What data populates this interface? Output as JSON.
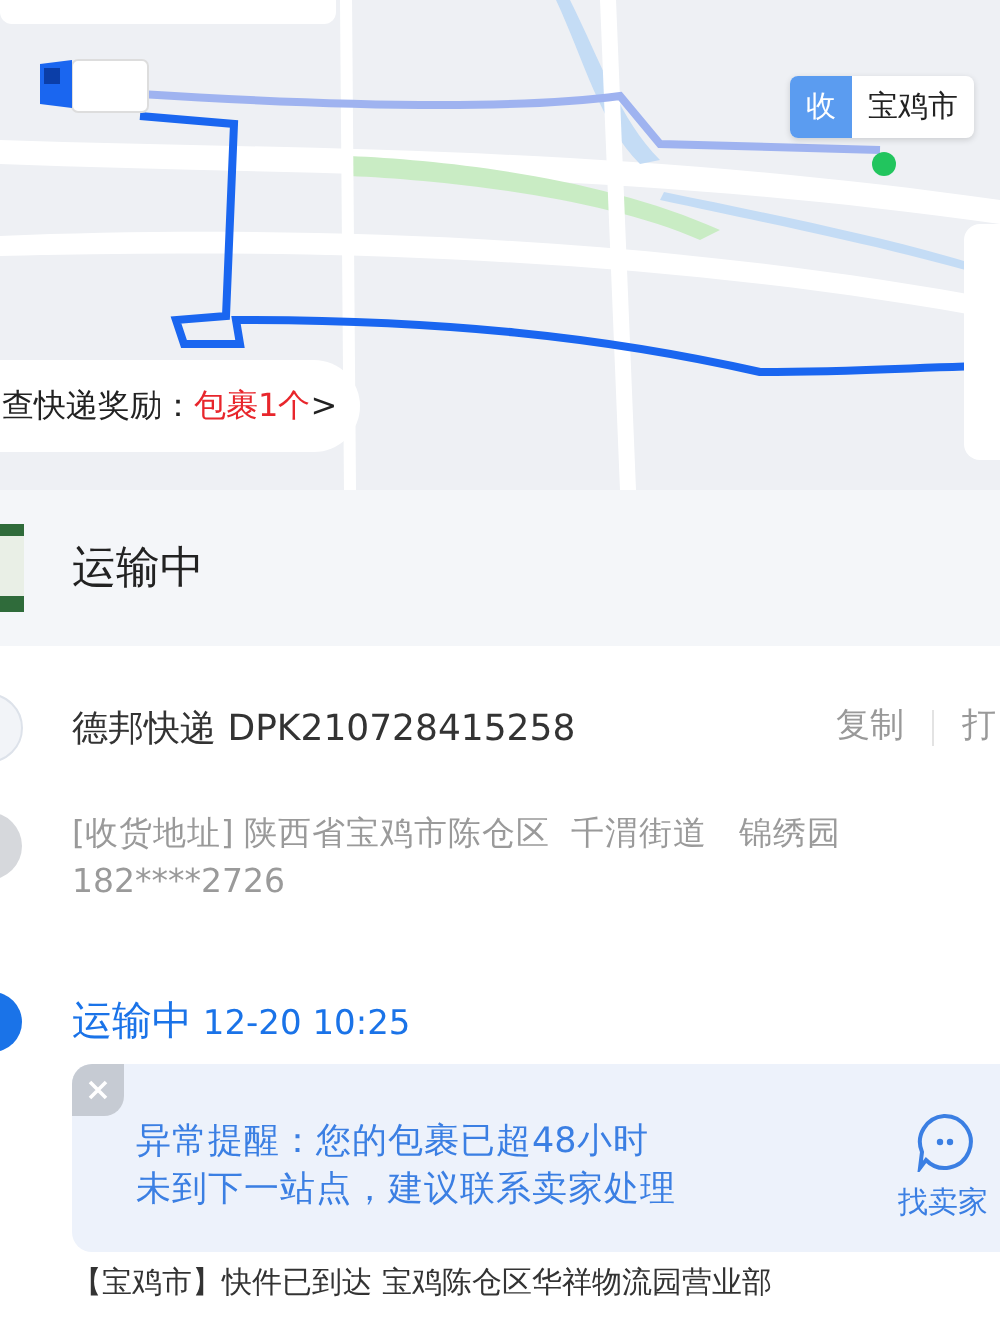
{
  "map": {
    "kind": "picture",
    "destination_marker": {
      "tag": "收",
      "label": "宝鸡市"
    },
    "reward_banner": {
      "label": "查快递奖励：",
      "highlight": "包裹1个",
      "arrow": ">"
    }
  },
  "status": {
    "title": "运输中"
  },
  "courier": {
    "name": "德邦快递 DPK210728415258",
    "actions": [
      {
        "label": "复制"
      },
      {
        "label": "打"
      }
    ]
  },
  "address": {
    "text": "[收货地址] 陕西省宝鸡市陈仓区  千渭街道   锦绣园",
    "phone": "182****2726"
  },
  "timeline": [
    {
      "status": "运输中",
      "time": "12-20 10:25",
      "current": true,
      "alert": {
        "text": "异常提醒：您的包裹已超48小时未到下一站点，建议联系卖家处理",
        "action": "找卖家"
      },
      "detail": "【宝鸡市】快件已到达 宝鸡陈仓区华祥物流园营业部"
    }
  ]
}
